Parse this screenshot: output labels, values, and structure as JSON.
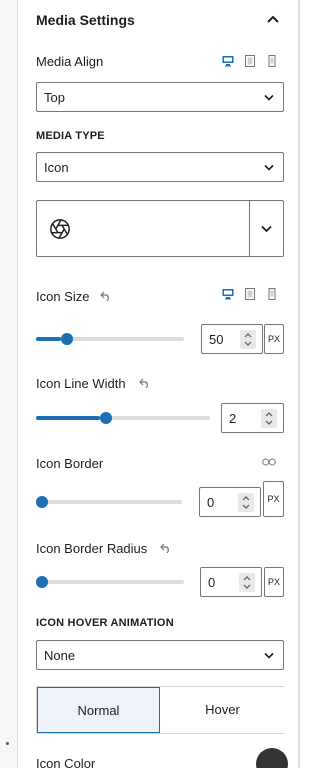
{
  "section": {
    "title": "Media Settings"
  },
  "media_align": {
    "label": "Media Align",
    "value": "Top"
  },
  "media_type": {
    "label": "MEDIA TYPE",
    "value": "Icon"
  },
  "icon_picker": {
    "icon": "aperture-icon"
  },
  "icon_size": {
    "label": "Icon Size",
    "value": "50",
    "unit": "PX",
    "level": 0.17
  },
  "icon_line_width": {
    "label": "Icon Line Width",
    "value": "2",
    "level": 0.37
  },
  "icon_border": {
    "label": "Icon Border",
    "value": "0",
    "unit": "PX",
    "level": 0.0
  },
  "icon_border_radius": {
    "label": "Icon Border Radius",
    "value": "0",
    "unit": "PX",
    "level": 0.0
  },
  "icon_hover_animation": {
    "label": "ICON HOVER ANIMATION",
    "value": "None"
  },
  "state_tabs": {
    "normal": "Normal",
    "hover": "Hover"
  },
  "icon_color": {
    "label": "Icon Color",
    "color": "#333333"
  },
  "colors": {
    "accent": "#1a6fb5"
  }
}
